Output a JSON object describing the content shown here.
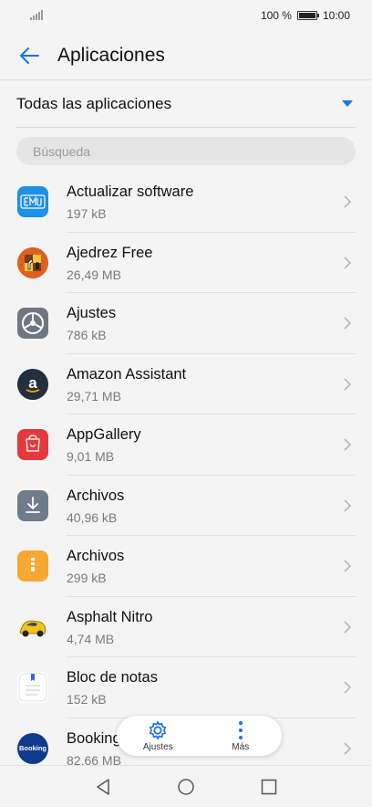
{
  "status_bar": {
    "battery_text": "100 %",
    "time": "10:00"
  },
  "header": {
    "title": "Aplicaciones",
    "back_icon": "arrow-left-icon",
    "accent_color": "#1a73e8"
  },
  "filter": {
    "label": "Todas las aplicaciones"
  },
  "search": {
    "placeholder": "Búsqueda"
  },
  "apps": [
    {
      "name": "Actualizar software",
      "size": "197 kB",
      "icon": "emui-update-icon"
    },
    {
      "name": "Ajedrez Free",
      "size": "26,49 MB",
      "icon": "chess-icon"
    },
    {
      "name": "Ajustes",
      "size": "786 kB",
      "icon": "settings-app-icon"
    },
    {
      "name": "Amazon Assistant",
      "size": "29,71 MB",
      "icon": "amazon-icon"
    },
    {
      "name": "AppGallery",
      "size": "9,01 MB",
      "icon": "appgallery-icon"
    },
    {
      "name": "Archivos",
      "size": "40,96 kB",
      "icon": "download-archive-icon"
    },
    {
      "name": "Archivos",
      "size": "299 kB",
      "icon": "files-icon"
    },
    {
      "name": "Asphalt Nitro",
      "size": "4,74 MB",
      "icon": "car-icon"
    },
    {
      "name": "Bloc de notas",
      "size": "152 kB",
      "icon": "notepad-icon"
    },
    {
      "name": "Booking.com",
      "size": "82,66 MB",
      "icon": "booking-icon",
      "icon_text": "Booking"
    }
  ],
  "toolbar": {
    "settings_label": "Ajustes",
    "more_label": "Más"
  }
}
